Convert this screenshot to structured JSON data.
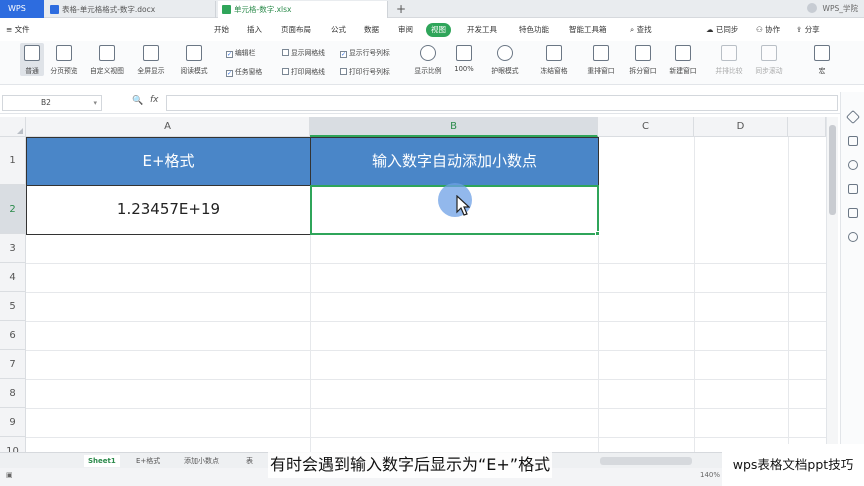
{
  "tabbar": {
    "logo": "WPS",
    "tabs": [
      {
        "label": "表格-单元格格式-数字.docx",
        "active": false
      },
      {
        "label": "单元格-数字.xlsx",
        "active": true
      }
    ],
    "plus": "+",
    "user": "WPS_学院"
  },
  "menubar": {
    "file": "≡ 文件",
    "items": [
      "开始",
      "插入",
      "页面布局",
      "公式",
      "数据",
      "审阅",
      "视图",
      "开发工具",
      "特色功能",
      "智能工具箱"
    ],
    "active_item": "视图",
    "search": "查找",
    "sync": "已同步",
    "collab": "协作",
    "share": "分享"
  },
  "ribbon": {
    "buttons": [
      "普通",
      "分页预览",
      "自定义视图",
      "全屏显示",
      "阅读模式",
      "显示比例",
      "100%",
      "护眼模式",
      "冻结窗格",
      "重排窗口",
      "拆分窗口",
      "新建窗口",
      "并排比较",
      "同步滚动",
      "宏"
    ],
    "checkboxes": [
      {
        "label": "编辑栏",
        "checked": true
      },
      {
        "label": "任务窗格",
        "checked": true
      },
      {
        "label": "显示网格线",
        "checked": false
      },
      {
        "label": "打印网格线",
        "checked": false
      },
      {
        "label": "显示行号列标",
        "checked": true
      },
      {
        "label": "打印行号列标",
        "checked": false
      }
    ]
  },
  "formula": {
    "cell_ref": "B2",
    "fx": "fx",
    "zoom_icon": "🔍",
    "value": ""
  },
  "grid": {
    "columns": [
      "A",
      "B",
      "C",
      "D"
    ],
    "rows": [
      "1",
      "2",
      "3",
      "4",
      "5",
      "6",
      "7",
      "8",
      "9",
      "10"
    ],
    "selected_col": "B",
    "selected_row": "2",
    "cells": {
      "A1": "E+格式",
      "B1": "输入数字自动添加小数点",
      "A2": "1.23457E+19",
      "B2": ""
    },
    "header_fill": "#4a86c8",
    "accent": "#2fa55a"
  },
  "sheets": [
    "Sheet1",
    "E+格式",
    "添加小数点",
    "表"
  ],
  "active_sheet": "Sheet1",
  "status": {
    "zoom": "140%"
  },
  "overlay": {
    "subtitle": "有时会遇到输入数字后显示为“E+”格式",
    "watermark": "wps表格文档ppt技巧"
  }
}
